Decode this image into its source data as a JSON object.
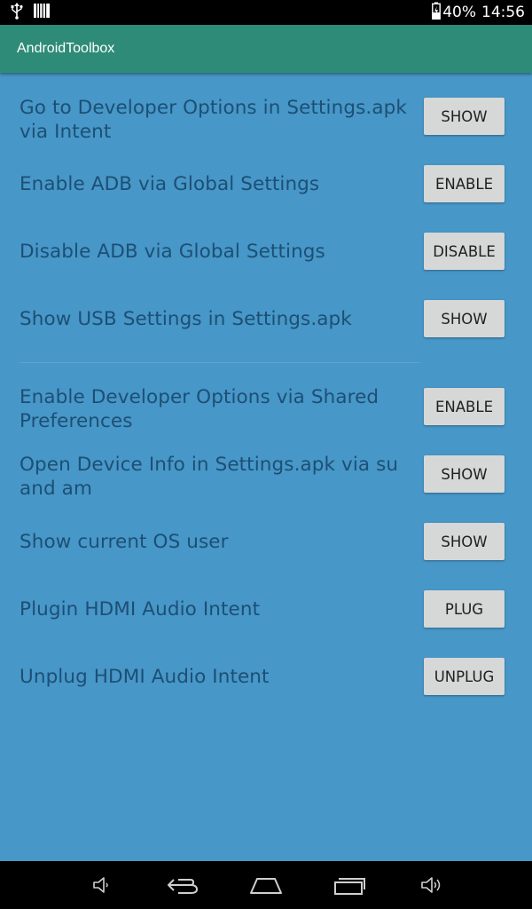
{
  "status_bar": {
    "battery": "40%",
    "time": "14:56",
    "icons": [
      "usb-icon",
      "barcode-icon",
      "battery-icon"
    ]
  },
  "app_bar": {
    "title": "AndroidToolbox"
  },
  "items": [
    {
      "label": "Go to Developer Options in Settings.apk via Intent",
      "button": "SHOW"
    },
    {
      "label": "Enable ADB via Global Settings",
      "button": "ENABLE"
    },
    {
      "label": "Disable ADB via Global Settings",
      "button": "DISABLE"
    },
    {
      "label": "Show USB Settings in Settings.apk",
      "button": "SHOW"
    },
    {
      "label": "Enable Developer Options via Shared Preferences",
      "button": "ENABLE"
    },
    {
      "label": "Open Device Info in Settings.apk via su and am",
      "button": "SHOW"
    },
    {
      "label": "Show current OS user",
      "button": "SHOW"
    },
    {
      "label": "Plugin HDMI Audio Intent",
      "button": "PLUG"
    },
    {
      "label": "Unplug HDMI Audio Intent",
      "button": "UNPLUG"
    }
  ],
  "nav_bar": {
    "icons": [
      "volume-down-icon",
      "back-icon",
      "home-icon",
      "recent-apps-icon",
      "volume-up-icon"
    ]
  },
  "colors": {
    "background": "#4797c8",
    "app_bar": "#2e8b77",
    "label_text": "#1d4f74",
    "button_bg": "#d6d7d7"
  }
}
